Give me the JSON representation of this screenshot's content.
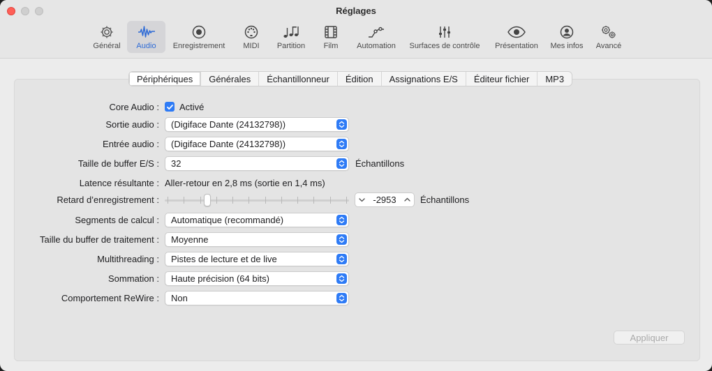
{
  "window": {
    "title": "Réglages"
  },
  "toolbar": {
    "items": [
      {
        "label": "Général",
        "icon": "gear-icon"
      },
      {
        "label": "Audio",
        "icon": "audio-waveform-icon",
        "active": true
      },
      {
        "label": "Enregistrement",
        "icon": "record-icon"
      },
      {
        "label": "MIDI",
        "icon": "midi-port-icon"
      },
      {
        "label": "Partition",
        "icon": "music-notes-icon"
      },
      {
        "label": "Film",
        "icon": "film-icon"
      },
      {
        "label": "Automation",
        "icon": "automation-curve-icon"
      },
      {
        "label": "Surfaces de contrôle",
        "icon": "faders-icon"
      },
      {
        "label": "Présentation",
        "icon": "eye-icon"
      },
      {
        "label": "Mes infos",
        "icon": "person-icon"
      },
      {
        "label": "Avancé",
        "icon": "gears-icon"
      }
    ],
    "accent": "#2e6bd6"
  },
  "tabs": [
    "Périphériques",
    "Générales",
    "Échantillonneur",
    "Édition",
    "Assignations E/S",
    "Éditeur fichier",
    "MP3"
  ],
  "form": {
    "core_audio": {
      "label": "Core Audio :",
      "checkbox_label": "Activé",
      "checked": true
    },
    "sortie": {
      "label": "Sortie audio :",
      "value": "(Digiface Dante (24132798))"
    },
    "entree": {
      "label": "Entrée audio :",
      "value": "(Digiface Dante (24132798))"
    },
    "buffer": {
      "label": "Taille de buffer E/S :",
      "value": "32",
      "unit": "Échantillons"
    },
    "latence": {
      "label": "Latence résultante :",
      "value": "Aller-retour en 2,8 ms (sortie en 1,4 ms)"
    },
    "retard": {
      "label": "Retard d’enregistrement :",
      "value": "-2953",
      "unit": "Échantillons",
      "slider_position": 0.22
    },
    "segments": {
      "label": "Segments de calcul :",
      "value": "Automatique (recommandé)"
    },
    "buffer_traitement": {
      "label": "Taille du buffer de traitement :",
      "value": "Moyenne"
    },
    "multithreading": {
      "label": "Multithreading :",
      "value": "Pistes de lecture et de live"
    },
    "sommation": {
      "label": "Sommation :",
      "value": "Haute précision (64 bits)"
    },
    "rewire": {
      "label": "Comportement ReWire :",
      "value": "Non"
    }
  },
  "apply_button": {
    "label": "Appliquer",
    "enabled": false
  },
  "colors": {
    "accent_blue": "#2e7bf6",
    "close_red": "#ff5f57"
  }
}
